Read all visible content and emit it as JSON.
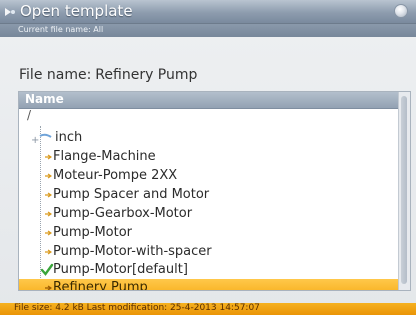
{
  "window": {
    "title": "Open template",
    "subtitle": "Current file name: All"
  },
  "file_name": {
    "label": "File name:",
    "value": "Refinery Pump"
  },
  "list": {
    "header": "Name",
    "root": "/",
    "folder": "inch",
    "items": [
      "Flange-Machine",
      "Moteur-Pompe 2XX",
      "Pump Spacer and Motor",
      "Pump-Gearbox-Motor",
      "Pump-Motor",
      "Pump-Motor-with-spacer",
      "Pump-Motor[default]",
      "Refinery Pump"
    ],
    "selected_index": 7,
    "default_index": 6
  },
  "status": {
    "text": "File size: 4.2 kB   Last modification:  25-4-2013  14:57:07"
  },
  "colors": {
    "accent": "#f6ac17",
    "titlebar": "#8d9cae",
    "check": "#3aa53a"
  },
  "icons": {
    "title": "template-icon",
    "close": "close-icon",
    "folder": "folder-icon",
    "item": "arrow-right-icon",
    "default": "checkmark-icon"
  }
}
